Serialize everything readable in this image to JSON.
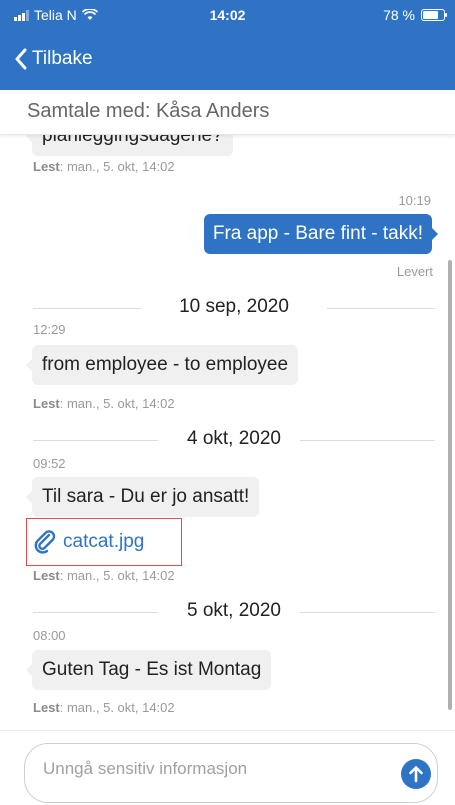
{
  "status_bar": {
    "carrier": "Telia N",
    "time": "14:02",
    "battery": "78 %"
  },
  "nav": {
    "back_label": "Tilbake"
  },
  "conversation": {
    "title": "Samtale med: Kåsa Anders"
  },
  "read_prefix": "Lest",
  "messages": {
    "top_partial": {
      "text": "planleggingsdagene?",
      "read_value": ": man., 5. okt, 14:02"
    },
    "sent": {
      "time": "10:19",
      "text": "Fra app - Bare fint - takk!",
      "status": "Levert"
    },
    "group1": {
      "date": "10 sep, 2020",
      "time": "12:29",
      "text": "from employee - to employee",
      "read_value": ": man., 5. okt, 14:02"
    },
    "group2": {
      "date": "4 okt, 2020",
      "time": "09:52",
      "text": "Til sara - Du er jo ansatt!",
      "attachment": "catcat.jpg",
      "read_value": ": man., 5. okt, 14:02"
    },
    "group3": {
      "date": "5 okt, 2020",
      "time": "08:00",
      "text": "Guten Tag - Es ist Montag",
      "read_value": ": man., 5. okt, 14:02"
    }
  },
  "composer": {
    "placeholder": "Unngå sensitiv informasjon"
  },
  "colors": {
    "primary": "#2f74c4",
    "incoming_bubble": "#f0f0f0",
    "muted_text": "#9a9a9a",
    "highlight_border": "#e04a4a"
  },
  "icons": {
    "back": "chevron-left-icon",
    "attachment": "paperclip-icon",
    "send": "arrow-up-icon",
    "wifi": "wifi-icon",
    "battery": "battery-icon"
  }
}
